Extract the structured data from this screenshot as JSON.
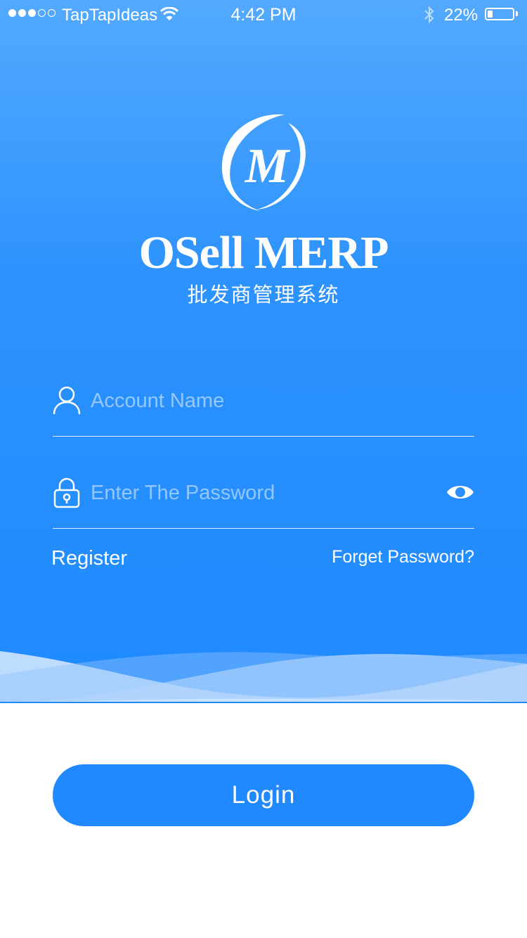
{
  "status_bar": {
    "signal_dots": 5,
    "signal_filled": 3,
    "carrier": "TapTapIdeas",
    "time": "4:42 PM",
    "battery_percent": "22%",
    "battery_level": 0.22,
    "icons": [
      "wifi-icon",
      "bluetooth-icon",
      "battery-icon"
    ]
  },
  "brand": {
    "logo_letter": "M",
    "name": "OSell MERP",
    "subtitle": "批发商管理系统"
  },
  "form": {
    "account_placeholder": "Account Name",
    "account_icon": "user-icon",
    "password_placeholder": "Enter The Password",
    "password_icon": "lock-icon",
    "visibility_icon": "eye-icon"
  },
  "links": {
    "register": "Register",
    "forget_password": "Forget Password?"
  },
  "login_button": "Login",
  "colors": {
    "gradient_top": "#53a9ff",
    "gradient_bottom": "#1f8aff",
    "button": "#2189ff",
    "text": "#ffffff"
  }
}
